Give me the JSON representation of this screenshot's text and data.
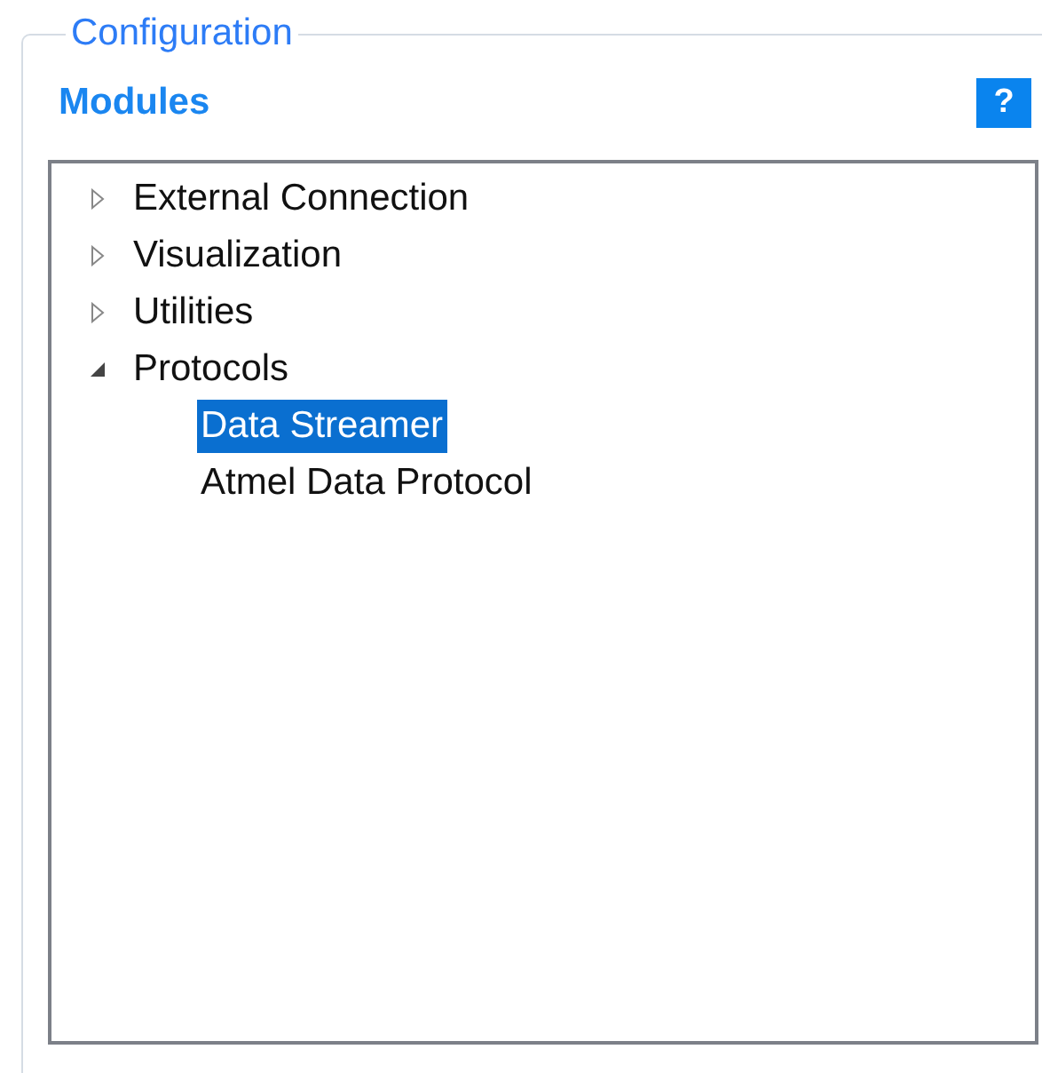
{
  "group": {
    "title": "Configuration"
  },
  "modules": {
    "title": "Modules",
    "help_label": "?",
    "tree": [
      {
        "label": "External Connection",
        "expanded": false,
        "selected": false
      },
      {
        "label": "Visualization",
        "expanded": false,
        "selected": false
      },
      {
        "label": "Utilities",
        "expanded": false,
        "selected": false
      },
      {
        "label": "Protocols",
        "expanded": true,
        "selected": false,
        "children": [
          {
            "label": "Data Streamer",
            "selected": true
          },
          {
            "label": "Atmel Data Protocol",
            "selected": false
          }
        ]
      }
    ]
  }
}
